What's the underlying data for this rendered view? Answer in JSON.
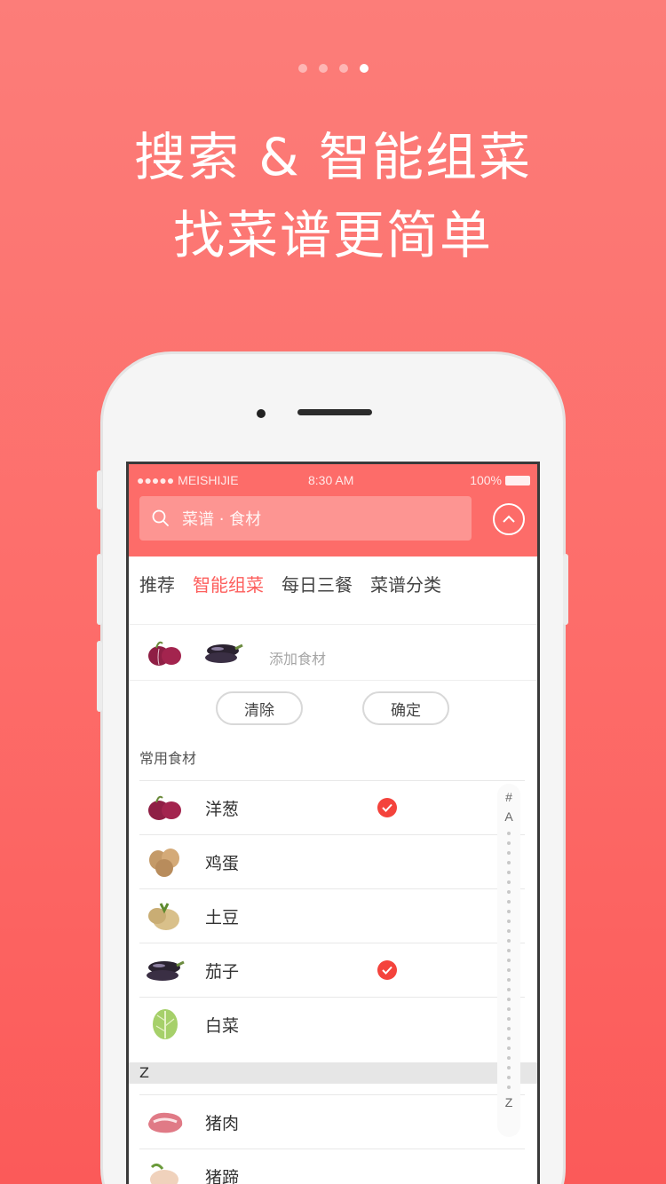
{
  "carousel": {
    "page_count": 4,
    "active_index": 3
  },
  "headline": {
    "line1": "搜索 & 智能组菜",
    "line2": "找菜谱更简单"
  },
  "status_bar": {
    "carrier": "●●●●● MEISHIJIE",
    "time": "8:30 AM",
    "battery": "100%"
  },
  "search": {
    "placeholder": "菜谱 · 食材"
  },
  "tabs": [
    {
      "label": "推荐",
      "active": false
    },
    {
      "label": "智能组菜",
      "active": true
    },
    {
      "label": "每日三餐",
      "active": false
    },
    {
      "label": "菜谱分类",
      "active": false
    }
  ],
  "picked": {
    "add_label": "添加食材",
    "items": [
      "onion-icon",
      "eggplant-icon"
    ]
  },
  "actions": {
    "clear": "清除",
    "confirm": "确定"
  },
  "common_title": "常用食材",
  "ingredients": [
    {
      "name": "洋葱",
      "icon": "onion-icon",
      "checked": true
    },
    {
      "name": "鸡蛋",
      "icon": "egg-icon",
      "checked": false
    },
    {
      "name": "土豆",
      "icon": "potato-icon",
      "checked": false
    },
    {
      "name": "茄子",
      "icon": "eggplant-icon",
      "checked": true
    },
    {
      "name": "白菜",
      "icon": "cabbage-icon",
      "checked": false
    }
  ],
  "section_z": "Z",
  "ingredients_z": [
    {
      "name": "猪肉",
      "icon": "pork-icon"
    },
    {
      "name": "猪蹄",
      "icon": "trotter-icon"
    }
  ],
  "index_bar": {
    "top": "#",
    "first": "A",
    "last": "Z"
  },
  "colors": {
    "brand": "#fd6c69",
    "accent": "#f4433c"
  }
}
